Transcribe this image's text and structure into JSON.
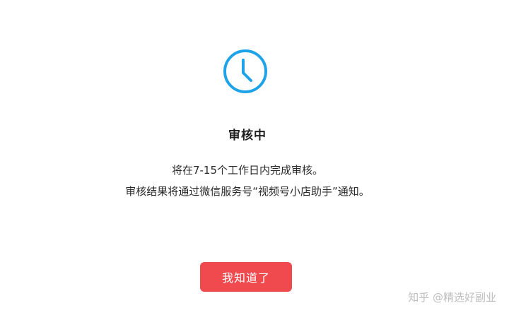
{
  "dialog": {
    "title": "审核中",
    "line1": "将在7-15个工作日内完成审核。",
    "line2": "审核结果将通过微信服务号“视频号小店助手”通知。",
    "button_label": "我知道了",
    "icon": "clock-icon",
    "accent_color": "#1fa3e8",
    "button_color": "#f04a4f"
  },
  "watermark": {
    "text": "知乎 @精选好副业"
  }
}
